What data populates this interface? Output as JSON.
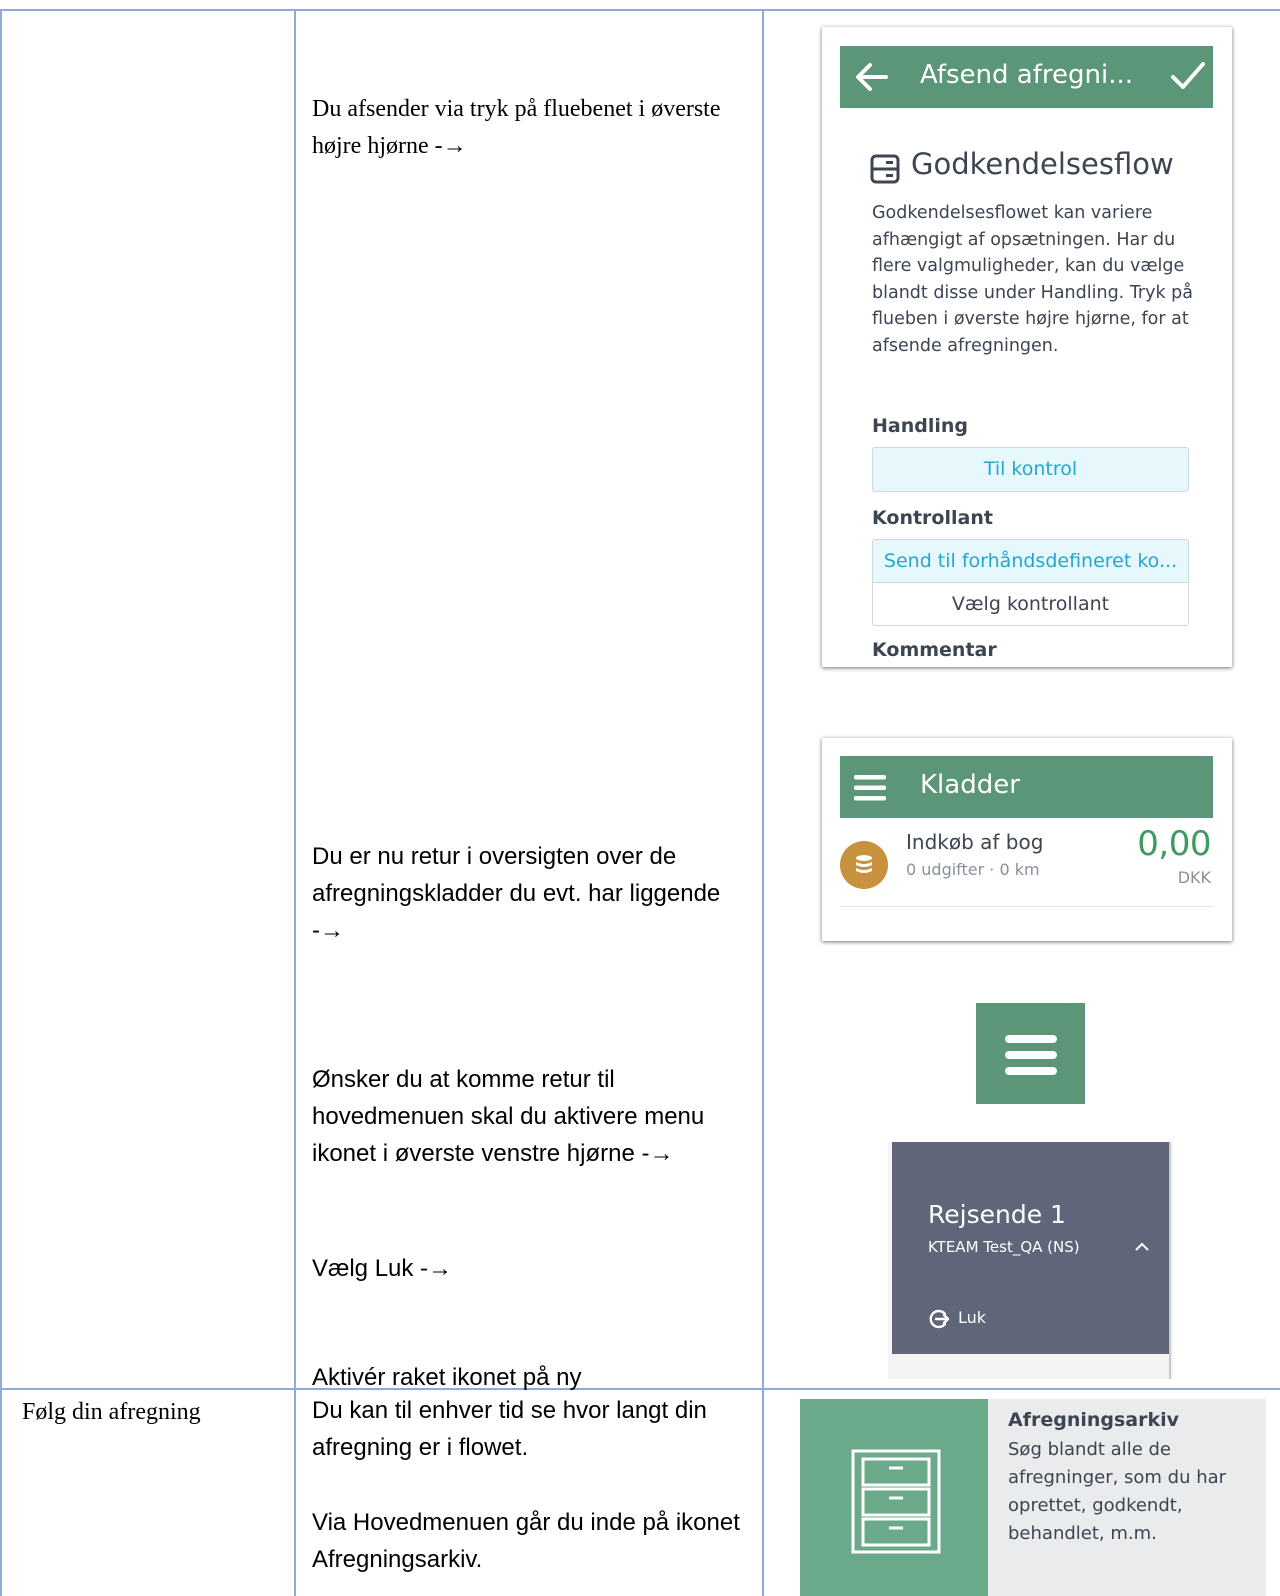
{
  "row1": {
    "col2": {
      "p1": "Du afsender via tryk på fluebenet i øverste højre hjørne -→",
      "p2": "Du er nu retur i oversigten over de afregningskladder du evt. har liggende -→",
      "p3": "Ønsker du at komme retur til hovedmenuen skal du aktivere menu ikonet i øverste venstre hjørne -→",
      "p4": "Vælg Luk -→",
      "p5": "Aktivér raket ikonet på ny"
    },
    "screen1": {
      "header_title": "Afsend afregni...",
      "section_title": "Godkendelsesflow",
      "description": "Godkendelsesflowet kan variere afhængigt af opsætningen. Har du flere valgmuligheder, kan du vælge blandt disse under Handling. Tryk på flueben i øverste højre hjørne, for at afsende afregningen.",
      "handling_label": "Handling",
      "handling_value": "Til kontrol",
      "kontrollant_label": "Kontrollant",
      "kontrollant_option1": "Send til forhåndsdefineret ko...",
      "kontrollant_option2": "Vælg kontrollant",
      "kommentar_label": "Kommentar"
    },
    "screen2": {
      "header_title": "Kladder",
      "item_title": "Indkøb af bog",
      "item_sub": "0 udgifter · 0 km",
      "amount": "0,00",
      "currency": "DKK"
    },
    "screen4": {
      "user_name": "Rejsende 1",
      "company": "KTEAM Test_QA (NS)",
      "close_label": "Luk"
    }
  },
  "row2": {
    "col1": "Følg din afregning",
    "col2": {
      "p1": "Du kan til enhver tid se hvor langt din afregning er i flowet.",
      "p2": "Via Hovedmenuen går du inde på ikonet Afregningsarkiv."
    },
    "tile": {
      "title": "Afregningsarkiv",
      "description": "Søg blandt alle de afregninger, som du har oprettet, godkendt, behandlet, m.m."
    }
  },
  "colors": {
    "table_border": "#8eaadb",
    "green": "#5a9677",
    "tile_green": "#6aaa8a",
    "menu_gray": "#5f6679",
    "accent_blue": "#25a6cf",
    "amount_green": "#3f9a5f",
    "coin_gold": "#c8913e"
  }
}
